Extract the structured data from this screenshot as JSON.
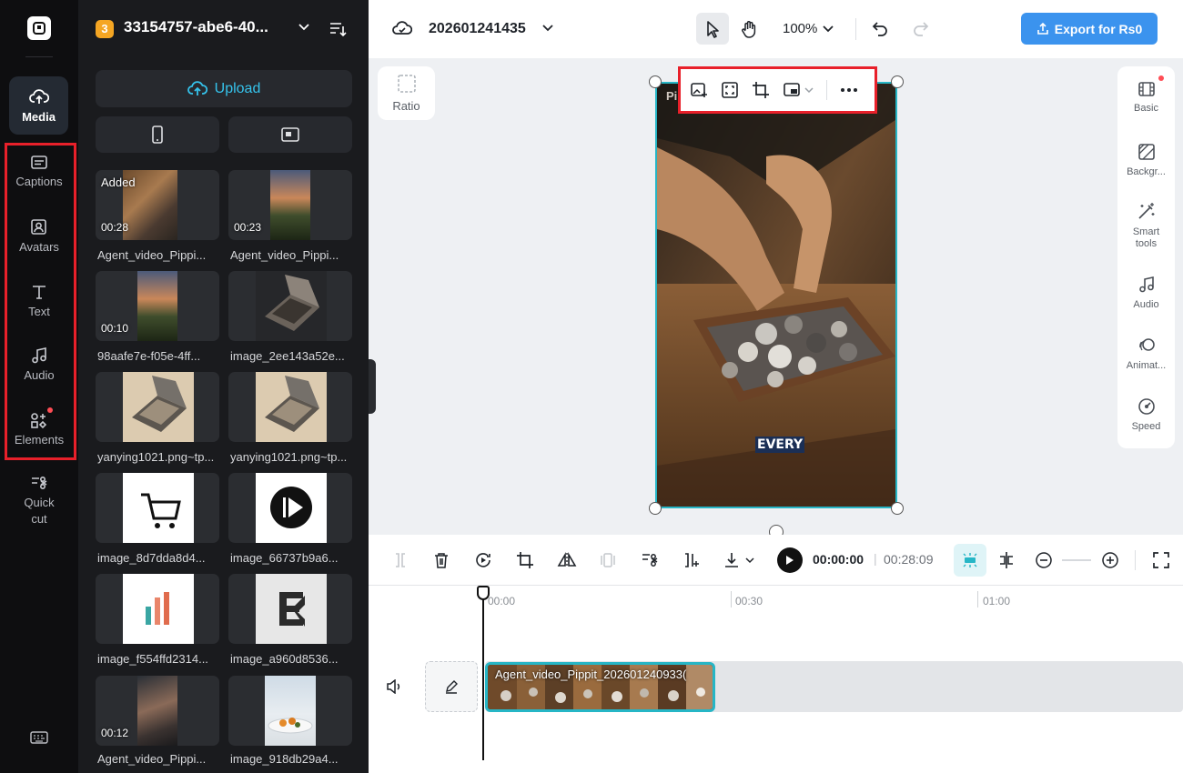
{
  "rail": {
    "items": [
      {
        "label": "Media",
        "icon": "cloud-upload-icon"
      },
      {
        "label": "Captions",
        "icon": "captions-icon"
      },
      {
        "label": "Avatars",
        "icon": "avatar-icon"
      },
      {
        "label": "Text",
        "icon": "text-icon"
      },
      {
        "label": "Audio",
        "icon": "music-note-icon"
      },
      {
        "label": "Elements",
        "icon": "elements-icon"
      },
      {
        "label": "Quick cut",
        "icon": "scissors-icon"
      }
    ]
  },
  "panel": {
    "project_badge": "3",
    "project_name": "33154757-abe6-40...",
    "upload_label": "Upload",
    "media": [
      {
        "name": "Agent_video_Pippi...",
        "duration": "00:28",
        "added": "Added",
        "kind": "workshop"
      },
      {
        "name": "Agent_video_Pippi...",
        "duration": "00:23",
        "kind": "sunset"
      },
      {
        "name": "98aafe7e-f05e-4ff...",
        "duration": "00:10",
        "kind": "sunset"
      },
      {
        "name": "image_2ee143a52e...",
        "kind": "palette-dark"
      },
      {
        "name": "yanying1021.png~tp...",
        "kind": "palette-beige"
      },
      {
        "name": "yanying1021.png~tp...",
        "kind": "palette-beige"
      },
      {
        "name": "image_8d7dda8d4...",
        "kind": "cart"
      },
      {
        "name": "image_66737b9a6...",
        "kind": "play"
      },
      {
        "name": "image_f554ffd2314...",
        "kind": "bars"
      },
      {
        "name": "image_a960d8536...",
        "kind": "logo-e"
      },
      {
        "name": "Agent_video_Pippi...",
        "duration": "00:12",
        "kind": "man"
      },
      {
        "name": "image_918db29a4...",
        "kind": "food"
      }
    ]
  },
  "topbar": {
    "project_title": "202601241435",
    "zoom": "100%",
    "export_label": "Export for Rs0"
  },
  "canvas": {
    "ratio_label": "Ratio",
    "caption_word": "EVERY",
    "watermark": "Pi"
  },
  "props": [
    {
      "label": "Basic",
      "icon": "film-icon"
    },
    {
      "label": "Backgr...",
      "icon": "background-icon"
    },
    {
      "label": "Smart tools",
      "icon": "magic-wand-icon"
    },
    {
      "label": "Audio",
      "icon": "music-note-icon"
    },
    {
      "label": "Animat...",
      "icon": "animation-icon"
    },
    {
      "label": "Speed",
      "icon": "speed-icon"
    }
  ],
  "timeline": {
    "current_time": "00:00:00",
    "separator": "|",
    "total_time": "00:28:09",
    "ruler": [
      "00:00",
      "00:30",
      "01:00"
    ],
    "clip_title": "Agent_video_Pippit_202601240933(",
    "colors": {
      "accent": "#26b6c6",
      "selection": "#e8202a"
    }
  }
}
